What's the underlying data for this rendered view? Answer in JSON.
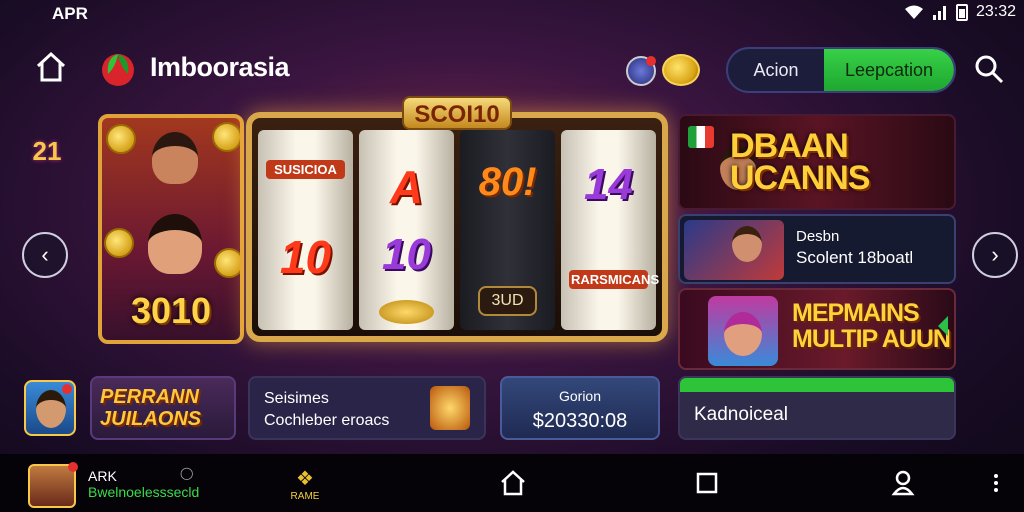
{
  "status": {
    "carrier": "APR",
    "time": "23:32",
    "icons": [
      "wifi-icon",
      "signal-icon",
      "battery-icon"
    ]
  },
  "header": {
    "brand": "Imboorasia",
    "toggle": {
      "option1": "Acion",
      "option2": "Leepcation"
    }
  },
  "side_promos": {
    "left": "21",
    "right": ""
  },
  "hero": {
    "amount": "3010"
  },
  "slot": {
    "title": "SCOI10",
    "reels": [
      {
        "symbols": [
          "SUSICIOA",
          "10"
        ]
      },
      {
        "symbols": [
          "A",
          "10"
        ]
      },
      {
        "symbols": [
          "80!",
          "",
          "3UD"
        ]
      },
      {
        "symbols": [
          "14",
          "RARSMICANS"
        ]
      }
    ]
  },
  "promo_banner": {
    "title": "DBAAN UCANNS"
  },
  "info_card": {
    "line1": "Desbn",
    "line2": "Scolent 18boatl"
  },
  "promo_banner2": {
    "title": "MEPMAINS MULTIP AUUN"
  },
  "bottom": {
    "promo_tile": "PERRANN JUILAONS",
    "session": {
      "line1": "Seisimes",
      "line2": "Cochleber eroacs"
    },
    "balance": {
      "label": "Gorion",
      "value": "$20330:08"
    },
    "casino": {
      "label": "Kadnoiceal"
    }
  },
  "nav": {
    "user_name": "ARK",
    "user_sub": "Bwelnoelesssecld",
    "games_label": "RAME"
  },
  "colors": {
    "accent_green": "#2ec43a",
    "gold": "#ffc83a",
    "bg_dark": "#1a0c26"
  }
}
